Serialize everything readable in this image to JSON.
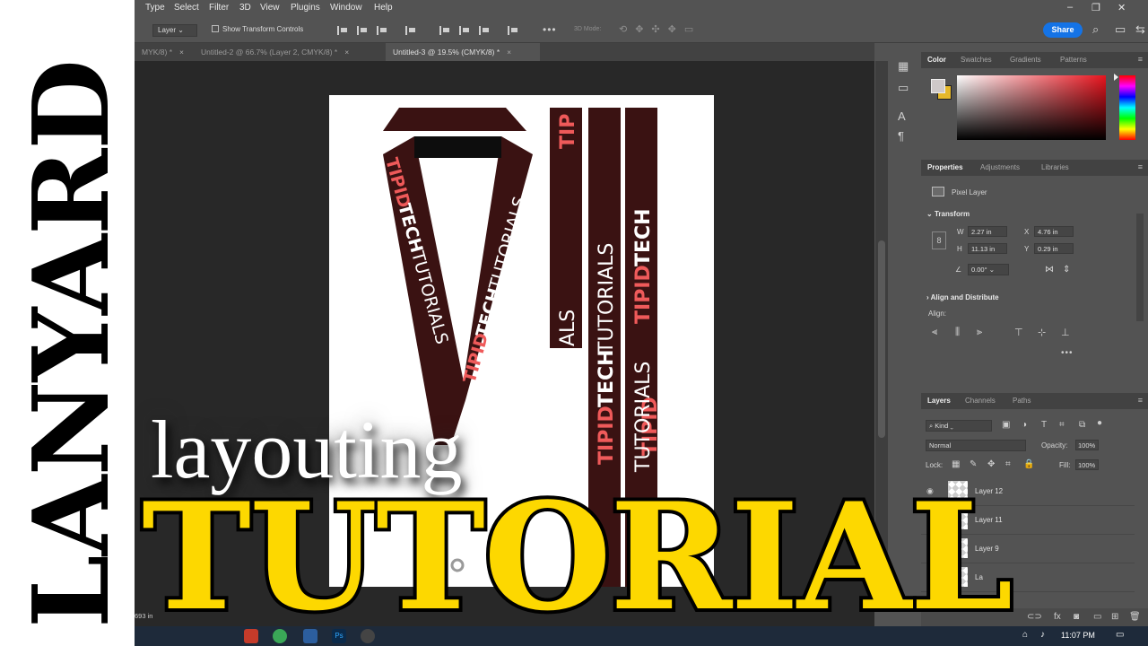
{
  "menubar": {
    "items": [
      "Type",
      "Select",
      "Filter",
      "3D",
      "View",
      "Plugins",
      "Window",
      "Help"
    ],
    "window_controls": [
      "–",
      "❐",
      "✕"
    ]
  },
  "options_bar": {
    "auto_select_value": "Layer",
    "show_transform_label": "Show Transform Controls",
    "mode_3d_label": "3D Mode:",
    "more_label": "•••",
    "share_label": "Share"
  },
  "tabs": [
    {
      "label": "MYK/8) *"
    },
    {
      "label": "Untitled-2 @ 66.7% (Layer 2, CMYK/8) *"
    },
    {
      "label": "Untitled-3 @ 19.5% (CMYK/8) *"
    }
  ],
  "artwork": {
    "lanyard_text_bold": "TIPIDTECH",
    "lanyard_text_light": "TUTORIALS",
    "tip_bold": "TIPID",
    "tech_bold": "TECH",
    "strip_top_text": "TIP",
    "strip_bottom_text": "ALS",
    "strap_color": "#3a1212",
    "accent_color": "#ef5a5a"
  },
  "color_panel": {
    "tabs": [
      "Color",
      "Swatches",
      "Gradients",
      "Patterns"
    ],
    "active_tab": "Color"
  },
  "properties_panel": {
    "tabs": [
      "Properties",
      "Adjustments",
      "Libraries"
    ],
    "active_tab": "Properties",
    "layer_type": "Pixel Layer",
    "transform_label": "Transform",
    "w_label": "W",
    "w_value": "2.27 in",
    "h_label": "H",
    "h_value": "11.13 in",
    "x_label": "X",
    "x_value": "4.76 in",
    "y_label": "Y",
    "y_value": "0.29 in",
    "angle_value": "0.00°",
    "align_section_label": "Align and Distribute",
    "align_label": "Align:",
    "more_label": "•••"
  },
  "layers_panel": {
    "tabs": [
      "Layers",
      "Channels",
      "Paths"
    ],
    "active_tab": "Layers",
    "kind_label": "Kind",
    "blend_mode": "Normal",
    "opacity_label": "Opacity:",
    "opacity_value": "100%",
    "lock_label": "Lock:",
    "fill_label": "Fill:",
    "fill_value": "100%",
    "layers": [
      {
        "name": "Layer 12"
      },
      {
        "name": "Layer 11"
      },
      {
        "name": "Layer 9"
      },
      {
        "name": "La"
      }
    ]
  },
  "status_bar": {
    "zoom_text": "693 in"
  },
  "taskbar": {
    "time": "11:07 PM"
  },
  "overlay": {
    "side_title": "LANYARD",
    "subtitle": "layouting",
    "main_title": "TUTORIAL"
  }
}
